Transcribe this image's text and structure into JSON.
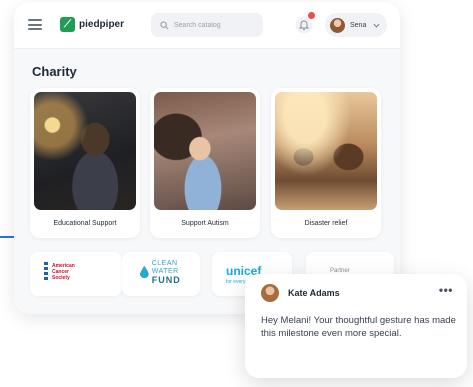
{
  "header": {
    "logo_text": "piedpiper",
    "search": {
      "placeholder": "Search catalog"
    },
    "user": {
      "name": "Sena"
    }
  },
  "main": {
    "section_title": "Charity",
    "charities": [
      {
        "label": "Educational Support",
        "image": "child-studying-by-lamp"
      },
      {
        "label": "Support Autism",
        "image": "mother-and-baby"
      },
      {
        "label": "Disaster relief",
        "image": "rescue-workers-flood"
      }
    ],
    "partners": [
      {
        "name": "American Cancer Society",
        "lines": [
          "American",
          "Cancer",
          "Society"
        ]
      },
      {
        "name": "Clean Water Fund",
        "line1": "CLEAN WATER",
        "line2": "FUND"
      },
      {
        "name": "unicef",
        "text": "unicef",
        "subtext": "for every child"
      },
      {
        "name": "fourth-partner",
        "text": "Partner"
      }
    ]
  },
  "message": {
    "author": "Kate Adams",
    "text": "Hey Melani! Your thoughtful gesture has made this milestone even more special.",
    "more_label": "•••"
  },
  "colors": {
    "accent": "#2f6fed",
    "brand_green": "#1f9d55",
    "notification": "#ef4b4b"
  }
}
